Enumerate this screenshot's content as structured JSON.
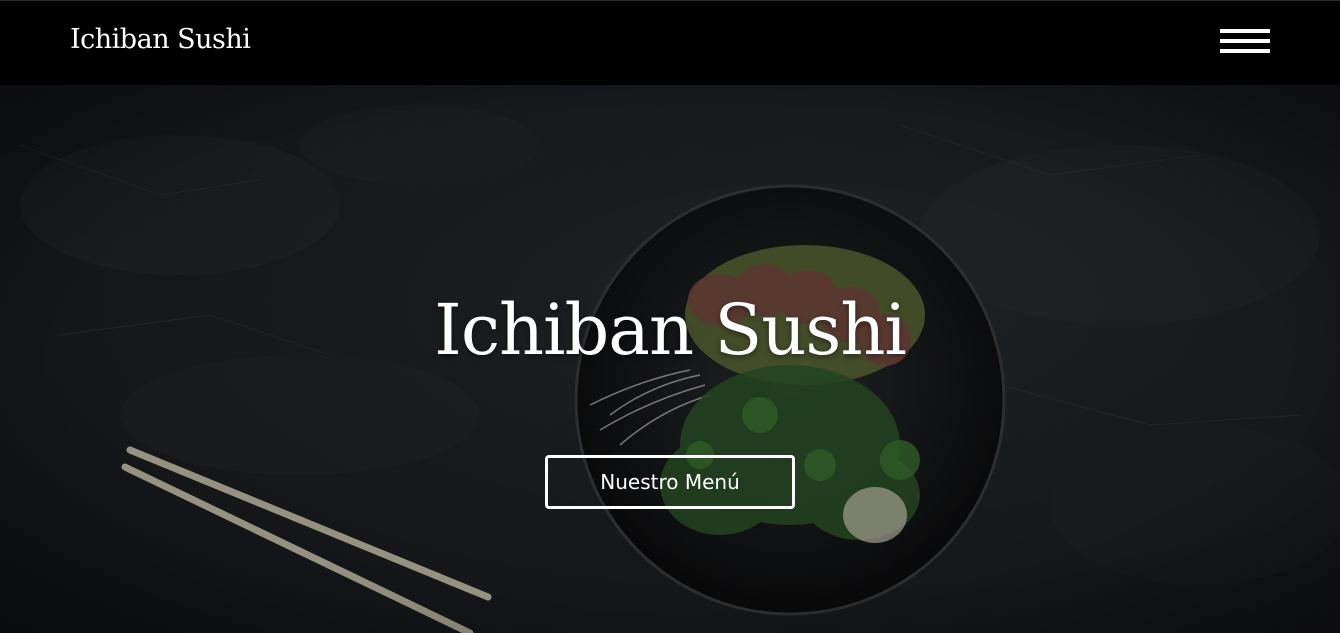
{
  "navbar": {
    "brand": "Ichiban Sushi",
    "menu_icon": "hamburger-menu-icon"
  },
  "hero": {
    "title": "Ichiban Sushi",
    "cta_label": "Nuestro Menú",
    "background_image": "sushi-bowl-with-chopsticks-photo"
  },
  "colors": {
    "navbar_bg": "#000000",
    "text": "#ffffff",
    "hero_bg": "#1f2225"
  }
}
